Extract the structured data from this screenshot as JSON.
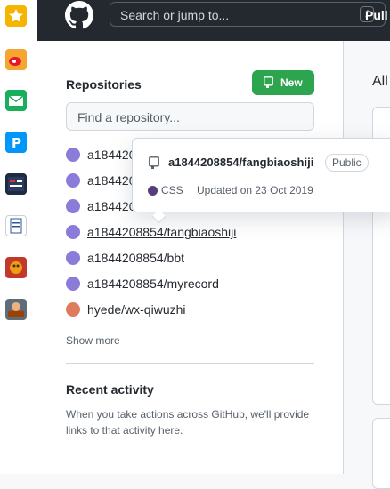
{
  "header": {
    "search_placeholder": "Search or jump to...",
    "search_shortcut": "/",
    "nav_pull": "Pull"
  },
  "sidebar": {
    "title": "Repositories",
    "new_button": "New",
    "find_placeholder": "Find a repository...",
    "repos": [
      {
        "name": "a184420",
        "avatar_color": "#8a7cd9"
      },
      {
        "name": "a184420",
        "avatar_color": "#8a7cd9"
      },
      {
        "name": "a184420",
        "avatar_color": "#8a7cd9"
      },
      {
        "name": "a1844208854/fangbiaoshiji",
        "avatar_color": "#8a7cd9"
      },
      {
        "name": "a1844208854/bbt",
        "avatar_color": "#8a7cd9"
      },
      {
        "name": "a1844208854/myrecord",
        "avatar_color": "#8a7cd9"
      },
      {
        "name": "hyede/wx-qiwuzhi",
        "avatar_color": "#e07a5f"
      }
    ],
    "show_more": "Show more",
    "recent_title": "Recent activity",
    "recent_text": "When you take actions across GitHub, we'll provide links to that activity here."
  },
  "main": {
    "all_label": "All"
  },
  "popover": {
    "repo_full_name": "a1844208854/fangbiaoshiji",
    "visibility": "Public",
    "language": "CSS",
    "language_color": "#563d7c",
    "updated": "Updated on 23 Oct 2019"
  },
  "dock": {
    "icons": [
      "star-app-icon",
      "weibo-icon",
      "mail-icon",
      "pixiv-app-icon",
      "news-app-icon",
      "document-icon",
      "game-app-icon",
      "game2-app-icon"
    ]
  },
  "colors": {
    "header_bg": "#24292f",
    "primary_button": "#2da44e"
  }
}
